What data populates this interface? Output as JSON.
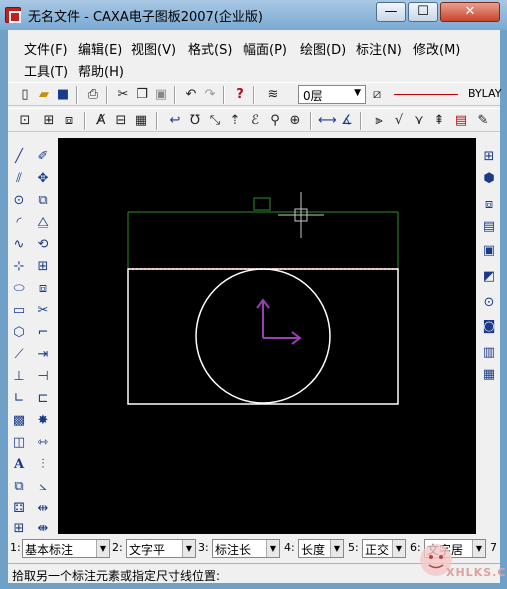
{
  "window": {
    "title": "无名文件 - CAXA电子图板2007(企业版)",
    "controls": {
      "minimize": "—",
      "maximize": "☐",
      "close": "✕"
    }
  },
  "menubar": {
    "row1": [
      "文件(F)",
      "编辑(E)",
      "视图(V)",
      "格式(S)",
      "幅面(P)",
      "绘图(D)",
      "标注(N)",
      "修改(M)"
    ],
    "row2": [
      "工具(T)",
      "帮助(H)"
    ]
  },
  "toolbar": {
    "layer": "0层",
    "linetype": "BYLAY"
  },
  "property_bar": [
    {
      "num": "1:",
      "value": "基本标注"
    },
    {
      "num": "2:",
      "value": "文字平"
    },
    {
      "num": "3:",
      "value": "标注长"
    },
    {
      "num": "4:",
      "value": "长度"
    },
    {
      "num": "5:",
      "value": "正交"
    },
    {
      "num": "6:",
      "value": "文字居"
    },
    {
      "num": "7",
      "value": ""
    }
  ],
  "status": {
    "prompt": "拾取另一个标注元素或指定尺寸线位置:"
  },
  "watermark": {
    "text": "XHLKS.C"
  },
  "colors": {
    "canvas": "#000000",
    "geometry": "#ffffff",
    "dimension": "#2e8b2e",
    "center_line": "#ff2020",
    "ucs_arrow": "#9b3fb5"
  }
}
